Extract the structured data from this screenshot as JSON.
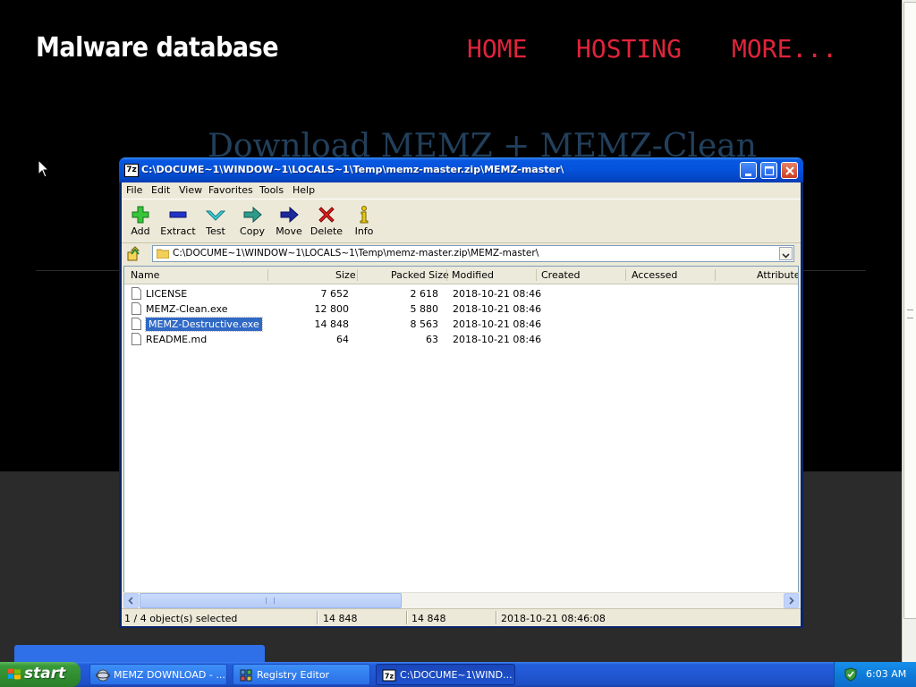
{
  "webpage": {
    "site_title": "Malware database",
    "nav": [
      "HOME",
      "HOSTING",
      "MORE..."
    ],
    "hero_heading": "Download MEMZ + MEMZ-Clean"
  },
  "window": {
    "title": "C:\\DOCUME~1\\WINDOW~1\\LOCALS~1\\Temp\\memz-master.zip\\MEMZ-master\\",
    "title_icon": "7z",
    "menu": [
      "File",
      "Edit",
      "View",
      "Favorites",
      "Tools",
      "Help"
    ],
    "toolbar": [
      {
        "label": "Add",
        "icon": "plus-icon"
      },
      {
        "label": "Extract",
        "icon": "minus-icon"
      },
      {
        "label": "Test",
        "icon": "check-icon"
      },
      {
        "label": "Copy",
        "icon": "copy-arrow-icon"
      },
      {
        "label": "Move",
        "icon": "move-arrow-icon"
      },
      {
        "label": "Delete",
        "icon": "delete-x-icon"
      },
      {
        "label": "Info",
        "icon": "info-icon"
      }
    ],
    "path": "C:\\DOCUME~1\\WINDOW~1\\LOCALS~1\\Temp\\memz-master.zip\\MEMZ-master\\",
    "columns": [
      "Name",
      "Size",
      "Packed Size",
      "Modified",
      "Created",
      "Accessed",
      "Attributes"
    ],
    "files": [
      {
        "name": "LICENSE",
        "size": "7 652",
        "packed": "2 618",
        "modified": "2018-10-21 08:46",
        "selected": false
      },
      {
        "name": "MEMZ-Clean.exe",
        "size": "12 800",
        "packed": "5 880",
        "modified": "2018-10-21 08:46",
        "selected": false
      },
      {
        "name": "MEMZ-Destructive.exe",
        "size": "14 848",
        "packed": "8 563",
        "modified": "2018-10-21 08:46",
        "selected": true
      },
      {
        "name": "README.md",
        "size": "64",
        "packed": "63",
        "modified": "2018-10-21 08:46",
        "selected": false
      }
    ],
    "status": {
      "selection": "1 / 4 object(s) selected",
      "size": "14 848",
      "packed": "14 848",
      "modified": "2018-10-21 08:46:08"
    }
  },
  "taskbar": {
    "start_label": "start",
    "tasks": [
      {
        "label": "MEMZ DOWNLOAD - ...",
        "icon": "browser-icon",
        "active": false
      },
      {
        "label": "Registry Editor",
        "icon": "registry-icon",
        "active": false
      },
      {
        "label": "C:\\DOCUME~1\\WIND...",
        "icon": "7zip-icon",
        "active": true
      }
    ],
    "clock": "6:03 AM"
  },
  "colors": {
    "nav": "#e0243b",
    "hero": "#22405c",
    "selection": "#316ac5",
    "titlebar": "#0453dc"
  }
}
